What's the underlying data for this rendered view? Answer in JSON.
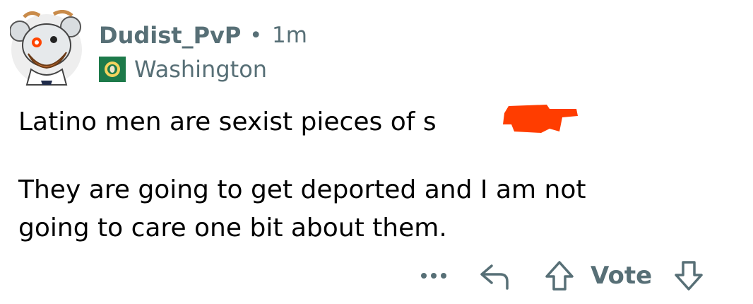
{
  "comment": {
    "author": "Dudist_PvP",
    "separator": "•",
    "timestamp": "1m",
    "flair": "Washington",
    "paragraphs": [
      "Latino men are sexist pieces of s",
      "They are going to get deported and I am not\ngoing to care one bit about them."
    ]
  },
  "actions": {
    "more_label": "...",
    "vote_label": "Vote"
  },
  "colors": {
    "meta_gray": "#576f76",
    "redaction": "#ff3d00",
    "flair_green": "#1d7a4a"
  },
  "icons": {
    "avatar": "snoo-avatar-icon",
    "flair": "washington-flag-icon",
    "reply": "reply-arrow-icon",
    "upvote": "upvote-arrow-icon",
    "downvote": "downvote-arrow-icon"
  }
}
